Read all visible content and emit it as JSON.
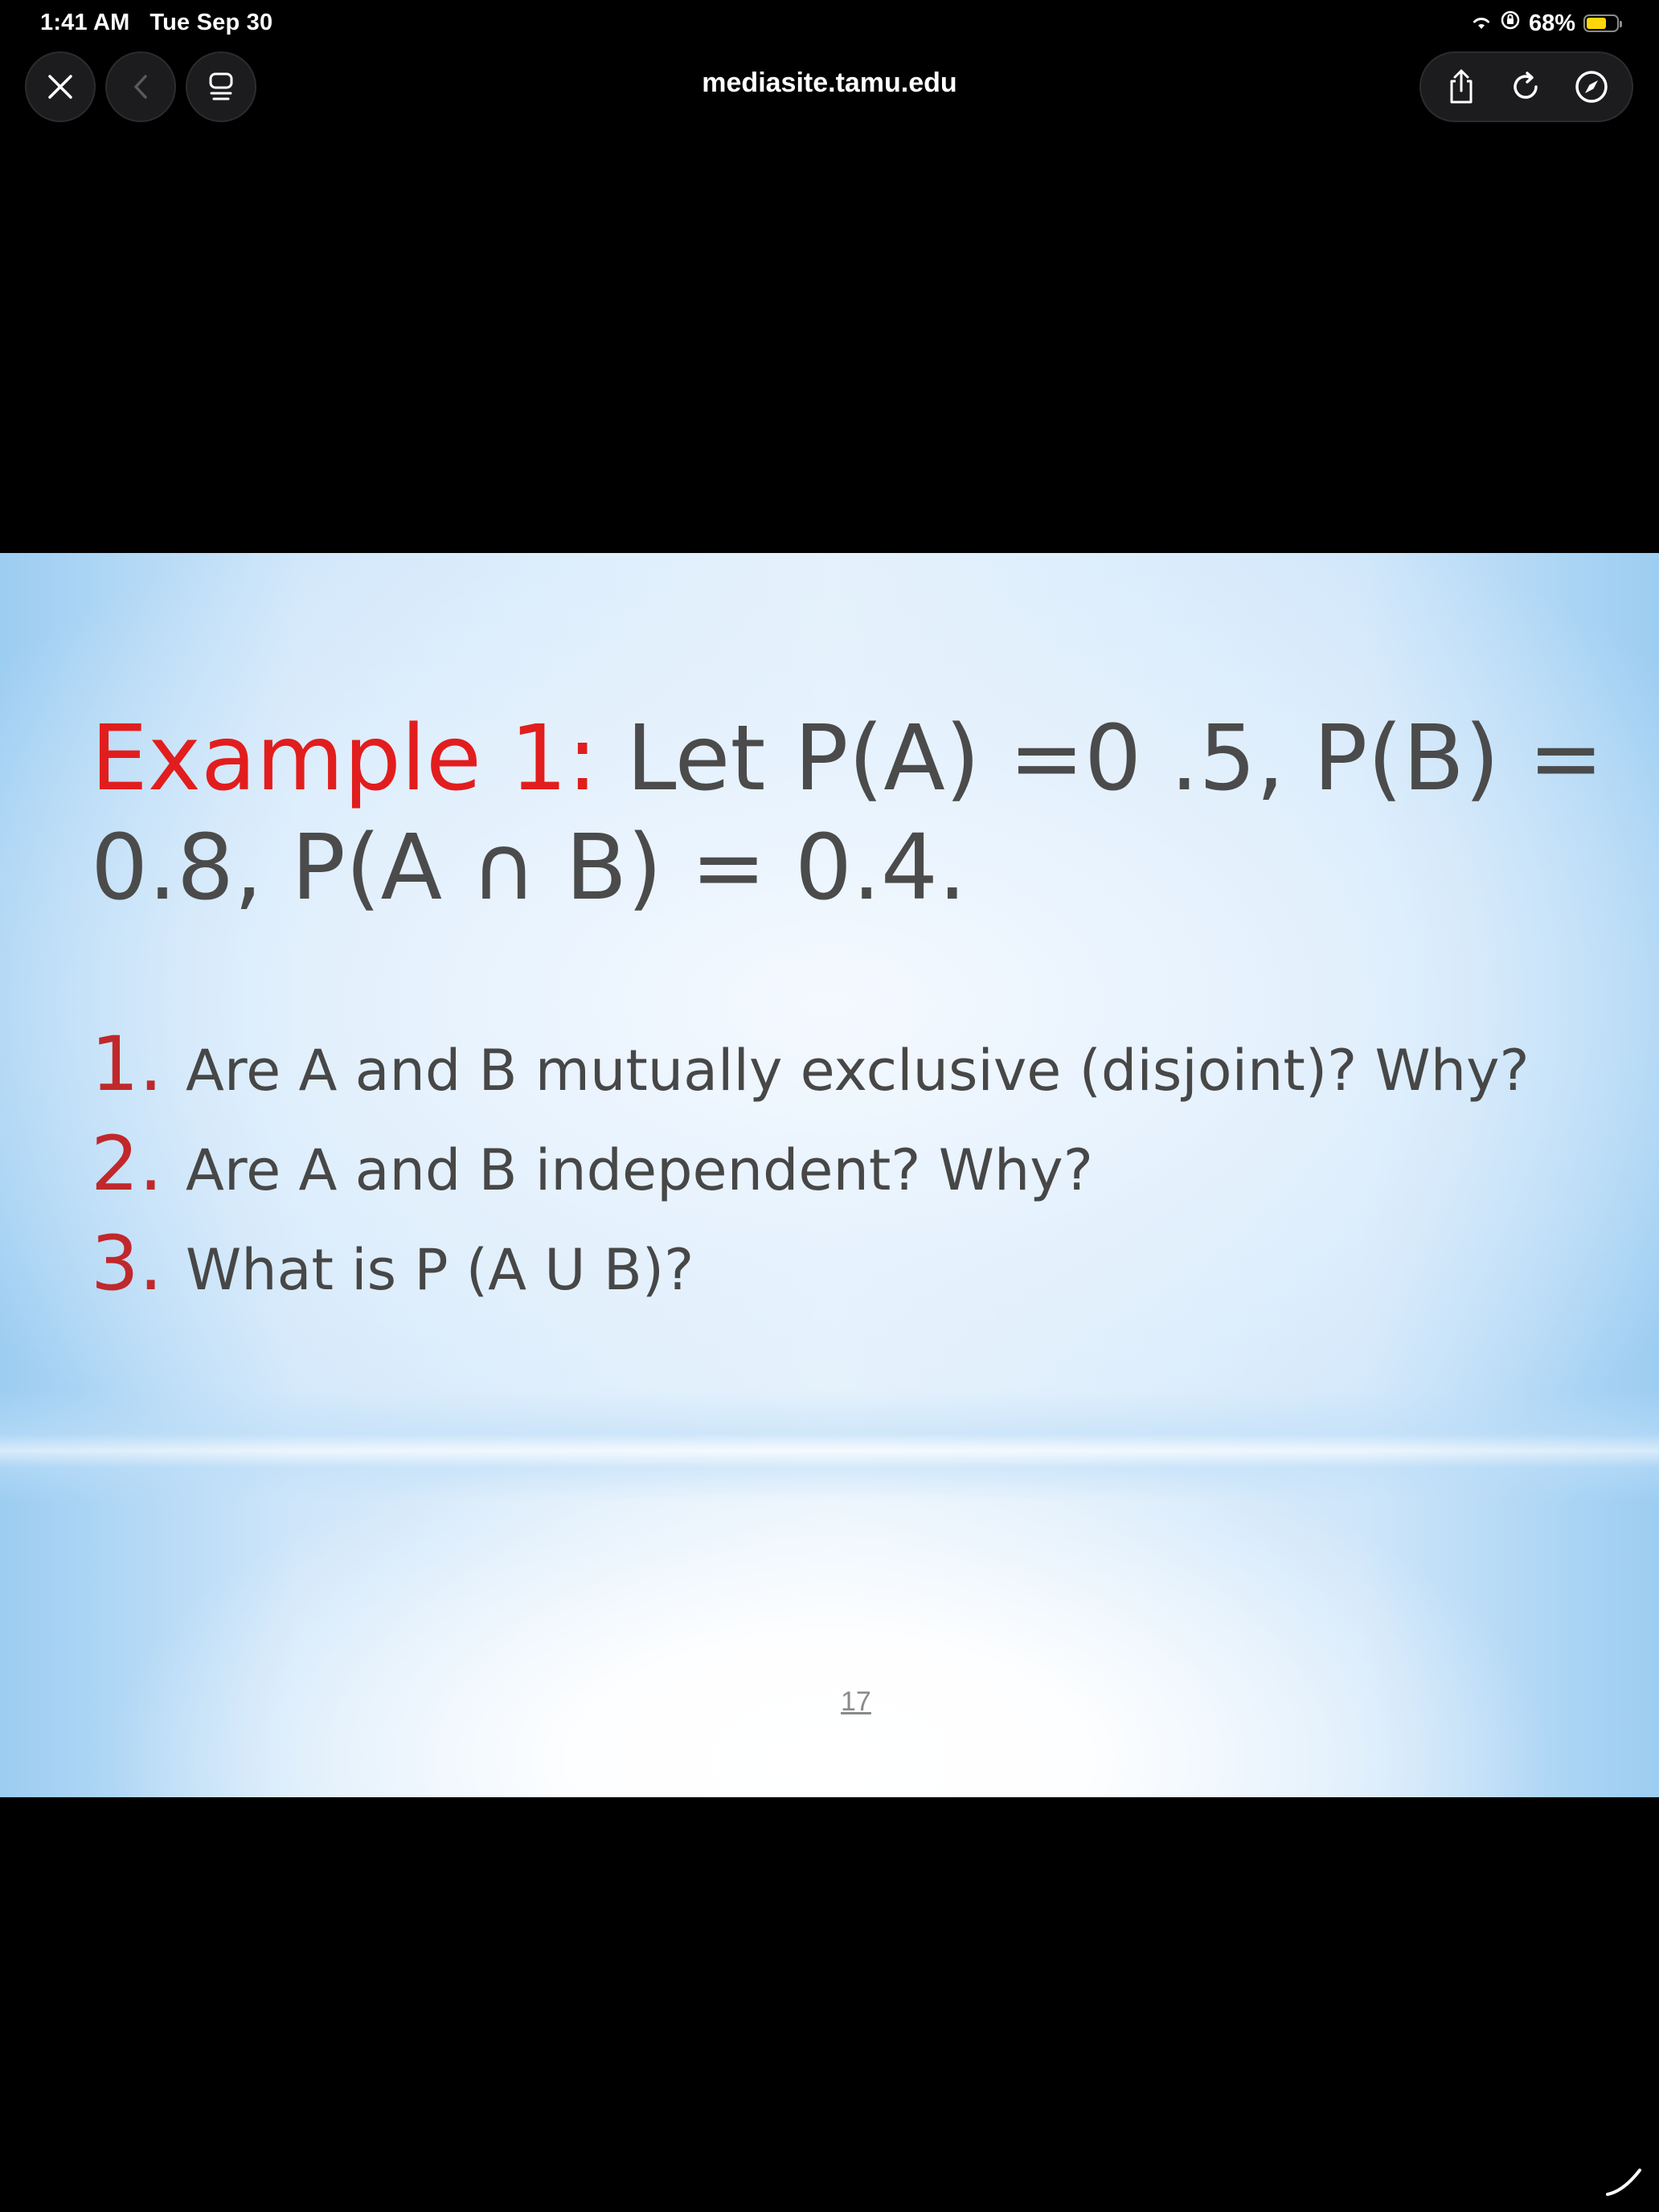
{
  "status_bar": {
    "time": "1:41 AM",
    "date": "Tue Sep 30",
    "battery_percent": "68%",
    "battery_level": 0.68,
    "battery_color": "#ffd60a",
    "icons": [
      "wifi-icon",
      "orientation-lock-icon",
      "battery-icon"
    ]
  },
  "toolbar": {
    "url": "mediasite.tamu.edu",
    "left_icons": [
      "close-icon",
      "back-icon",
      "tabs-icon"
    ],
    "right_icons": [
      "share-icon",
      "reload-icon",
      "compass-icon"
    ]
  },
  "slide": {
    "title_label": "Example 1:",
    "title_line1": " Let P(A) =0 .5, P(B) =",
    "title_line2": "0.8, P(A ∩ B) = 0.4.",
    "questions": [
      {
        "num": "1.",
        "text": "Are A and B mutually exclusive (disjoint)? Why?"
      },
      {
        "num": "2.",
        "text": "Are A and B independent? Why?"
      },
      {
        "num": "3.",
        "text": "What is P (A U B)?"
      }
    ],
    "page_number": "17",
    "accent_color": "#e21d1d",
    "number_color": "#c0282b"
  }
}
